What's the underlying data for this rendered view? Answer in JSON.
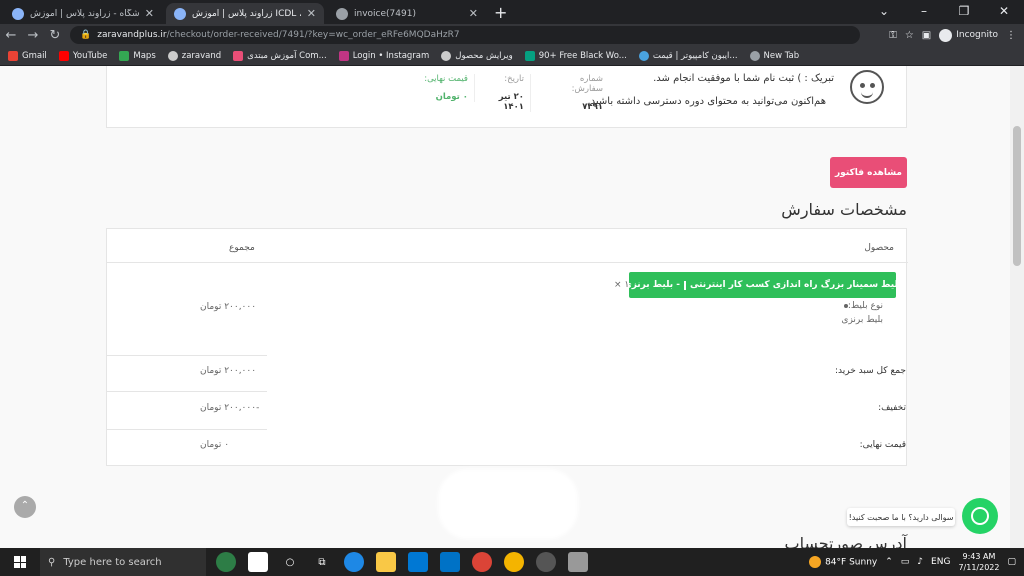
{
  "browser": {
    "tabs": [
      {
        "title": "فروشگاه - زراوند پلاس | آموزش ICDL",
        "active": false
      },
      {
        "title": "زراوند پلاس | آموزش ICDL ، نصب و",
        "active": true
      },
      {
        "title": "invoice(7491)",
        "active": false
      }
    ],
    "new_tab": "+",
    "url_host": "zaravandplus.ir",
    "url_path": "/checkout/order-received/7491/?key=wc_order_eRFe6MQDaHzR7",
    "profile": "Incognito",
    "bookmarks": [
      "Gmail",
      "YouTube",
      "Maps",
      "zaravand",
      "آموزش مبتدی Com...",
      "Login • Instagram",
      "ویرایش محصول",
      "90+ Free Black Wo...",
      "ایبون کامپیوتر | قیمت...",
      "New Tab"
    ]
  },
  "order": {
    "success_msg": "تبریک : ) ثبت نام شما با موفقیت انجام شد.",
    "access_msg": "هم‌اکنون می‌توانید به محتوای دوره دسترسی داشته باشید.",
    "number_label": "شماره سفارش:",
    "number": "۷۴۹۱",
    "date_label": "تاریخ:",
    "date": "۲۰ تیر ۱۴۰۱",
    "price_label": "قیمت نهایی:",
    "price": "۰ تومان"
  },
  "invoice_button": "مشاهده فاکتور",
  "order_details_title": "مشخصات سفارش",
  "table": {
    "col_product": "محصول",
    "col_total": "مجموع",
    "product_name": "بلیط سمینار بزرگ راه اندازی کسب کار اینترنتی",
    "product_suffix": "- بلیط برنزی",
    "qty": "× ۱",
    "ticket_type_label": "نوع بلیط:",
    "ticket_type": "بلیط برنزی",
    "line_total": "۲۰۰,۰۰۰ تومان",
    "subtotal_label": "جمع کل سبد خرید:",
    "subtotal": "۲۰۰,۰۰۰ تومان",
    "discount_label": "تخفیف:",
    "discount": "-۲۰۰,۰۰۰ تومان",
    "final_label": "قیمت نهایی:",
    "final": "۰ تومان"
  },
  "chat_bubble": "سوالی دارید؟ با ما صحبت کنید!",
  "billing_title": "آدرس صورتحساب",
  "taskbar": {
    "search_placeholder": "Type here to search",
    "weather": "84°F  Sunny",
    "lang": "ENG",
    "time": "9:43 AM",
    "date": "7/11/2022"
  }
}
